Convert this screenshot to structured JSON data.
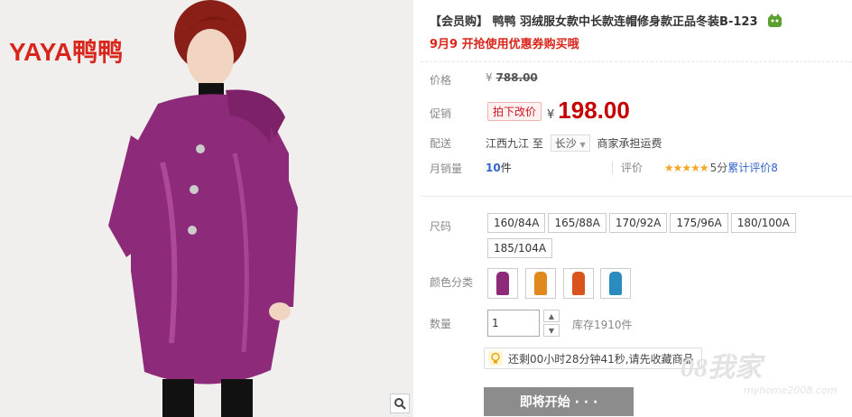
{
  "brand": {
    "logo_text": "YAYA鸭鸭"
  },
  "product": {
    "title": "【会员购】 鸭鸭 羽绒服女款中长款连帽修身款正品冬装B-123",
    "subtitle": "9月9 开抢使用优惠券购买哦"
  },
  "price": {
    "label": "价格",
    "currency": "¥",
    "original": "788.00",
    "promo_label": "促销",
    "promo_tag": "拍下改价",
    "promo_currency": "¥",
    "promo_value": "198.00"
  },
  "shipping": {
    "label": "配送",
    "origin": "江西九江",
    "to": "至",
    "destination": "长沙",
    "fee_note": "商家承担运费"
  },
  "sales": {
    "label": "月销量",
    "count": "10",
    "unit": "件",
    "rating_label": "评价",
    "stars": "★★★★★",
    "score_text": "5分",
    "review_text": "累计评价8"
  },
  "sizes": {
    "label": "尺码",
    "options": [
      "160/84A",
      "165/88A",
      "170/92A",
      "175/96A",
      "180/100A",
      "185/104A"
    ]
  },
  "colors": {
    "label": "颜色分类",
    "swatch_colors": [
      "#8e2a7a",
      "#e08a1e",
      "#d9531c",
      "#2a8bbf"
    ]
  },
  "quantity": {
    "label": "数量",
    "value": "1",
    "stock": "库存1910件"
  },
  "tip": {
    "text": "还剩00小时28分钟41秒,请先收藏商品"
  },
  "buy_button": {
    "label": "即将开始 · · ·"
  },
  "watermark": {
    "main": "08我家",
    "url": "myhome2008.com"
  },
  "colors_theme": {
    "accent": "#c40000",
    "link": "#3366cc",
    "button": "#8c8c8c"
  }
}
